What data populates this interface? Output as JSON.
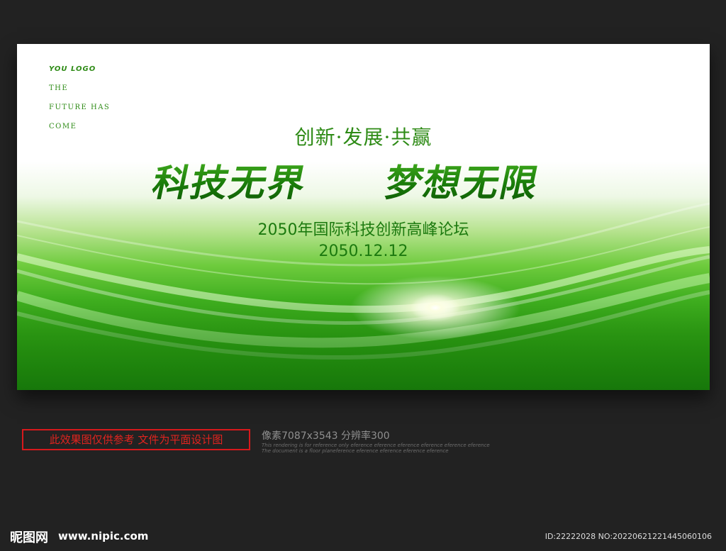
{
  "banner": {
    "logo": "YOU LOGO",
    "tagline": [
      "THE",
      "FUTURE HAS",
      "COME"
    ],
    "slogan": "创新·发展·共赢",
    "headline_left": "科技无界",
    "headline_right": "梦想无限",
    "forum_title": "2050年国际科技创新高峰论坛",
    "date": "2050.12.12"
  },
  "footer": {
    "notice": "此效果图仅供参考 文件为平面设计图",
    "pixel_info": "像素7087x3543  分辨率300",
    "ref_line_1": "This rendering is for reference only  eference eference eference eference eference eference",
    "ref_line_2": "The document is a floor planeference eference eference eference eference"
  },
  "watermark": {
    "site_logo": "昵图网",
    "site_url": "www.nipic.com",
    "id_info": "ID:22222028 NO:20220621221445060106"
  },
  "colors": {
    "background": "#222222",
    "primary_green": "#2e8b16",
    "dark_green": "#1c7a0f",
    "notice_red": "#d7191c"
  }
}
